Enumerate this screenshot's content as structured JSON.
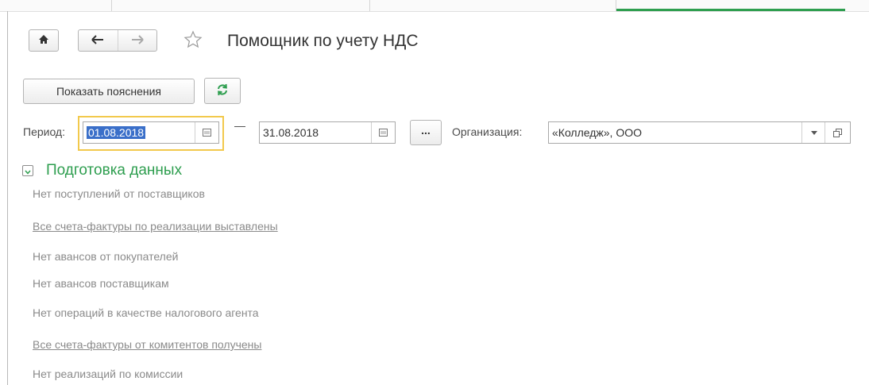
{
  "page_title": "Помощник по учету НДС",
  "toolbar": {
    "explain_label": "Показать пояснения"
  },
  "filters": {
    "period_label": "Период:",
    "date_from": "01.08.2018",
    "date_separator": "—",
    "date_to": "31.08.2018",
    "more_label": "...",
    "org_label": "Организация:",
    "org_value": "«Колледж», ООО"
  },
  "section": {
    "title": "Подготовка данных",
    "items": [
      {
        "label": "Нет поступлений от поставщиков",
        "link": false
      },
      {
        "label": "Все счета-фактуры по реализации выставлены",
        "link": true
      },
      {
        "label": "Нет авансов от покупателей",
        "link": false
      },
      {
        "label": "Нет авансов поставщикам",
        "link": false
      },
      {
        "label": "Нет операций в качестве налогового агента",
        "link": false
      },
      {
        "label": "Все счета-фактуры от комитентов получены",
        "link": true
      },
      {
        "label": "Нет реализаций по комиссии",
        "link": false
      }
    ]
  },
  "colors": {
    "accent_green": "#2e9e4f",
    "focus_yellow": "#f2c94c",
    "selection_blue": "#3a6fc9"
  },
  "icons": [
    "home-icon",
    "back-arrow-icon",
    "forward-arrow-icon",
    "star-icon",
    "refresh-icon",
    "calendar-icon",
    "chevron-down-icon",
    "open-window-icon"
  ]
}
